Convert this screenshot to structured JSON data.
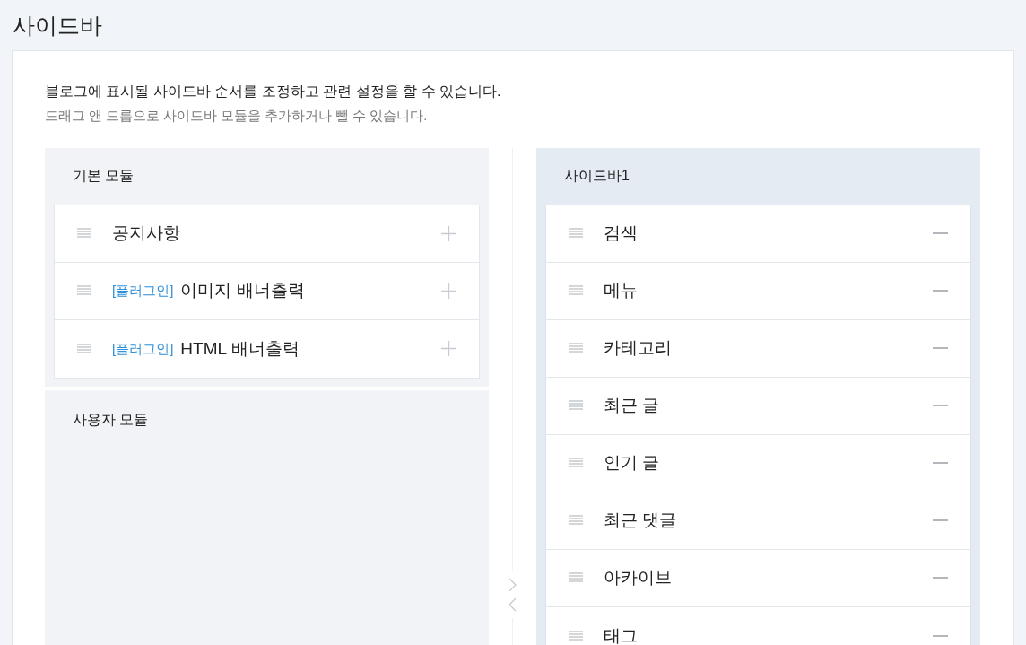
{
  "page_title": "사이드바",
  "description": "블로그에 표시될 사이드바 순서를 조정하고 관련 설정을 할 수 있습니다.",
  "hint": "드래그 앤 드롭으로 사이드바 모듈을 추가하거나 뺄 수 있습니다.",
  "basic_modules": {
    "title": "기본 모듈",
    "items": [
      {
        "name": "공지사항"
      },
      {
        "tag": "[플러그인]",
        "name": "이미지 배너출력"
      },
      {
        "tag": "[플러그인]",
        "name": "HTML 배너출력"
      }
    ]
  },
  "user_modules": {
    "title": "사용자 모듈"
  },
  "sidebar": {
    "title": "사이드바1",
    "items": [
      {
        "name": "검색"
      },
      {
        "name": "메뉴"
      },
      {
        "name": "카테고리"
      },
      {
        "name": "최근 글"
      },
      {
        "name": "인기 글"
      },
      {
        "name": "최근 댓글"
      },
      {
        "name": "아카이브"
      },
      {
        "name": "태그"
      }
    ]
  }
}
